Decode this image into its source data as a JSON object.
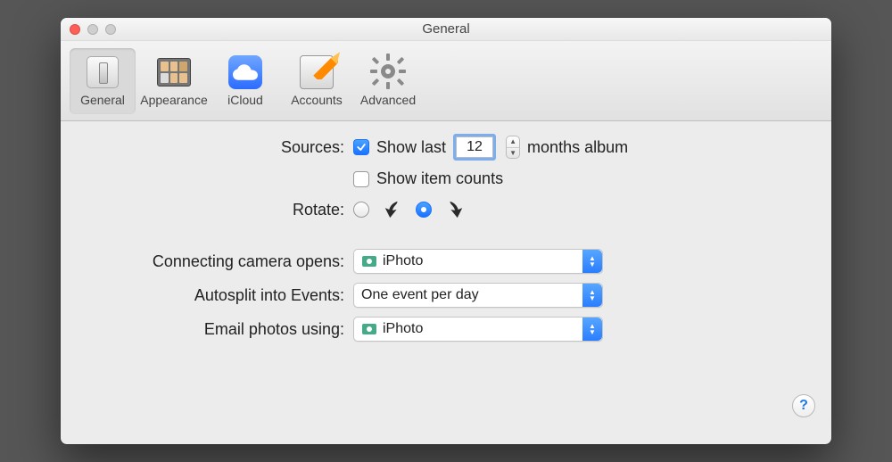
{
  "window": {
    "title": "General"
  },
  "toolbar": {
    "items": [
      {
        "label": "General",
        "icon": "general-icon",
        "selected": true
      },
      {
        "label": "Appearance",
        "icon": "appearance-icon",
        "selected": false
      },
      {
        "label": "iCloud",
        "icon": "icloud-icon",
        "selected": false
      },
      {
        "label": "Accounts",
        "icon": "accounts-icon",
        "selected": false
      },
      {
        "label": "Advanced",
        "icon": "advanced-icon",
        "selected": false
      }
    ]
  },
  "form": {
    "sources_label": "Sources:",
    "show_last_checked": true,
    "show_last_prefix": "Show last",
    "show_last_value": "12",
    "show_last_suffix": "months album",
    "show_item_counts_checked": false,
    "show_item_counts_label": "Show item counts",
    "rotate_label": "Rotate:",
    "rotate_selected": "cw",
    "camera_label": "Connecting camera opens:",
    "camera_value": "iPhoto",
    "autosplit_label": "Autosplit into Events:",
    "autosplit_value": "One event per day",
    "email_label": "Email photos using:",
    "email_value": "iPhoto"
  },
  "help": {
    "symbol": "?"
  }
}
